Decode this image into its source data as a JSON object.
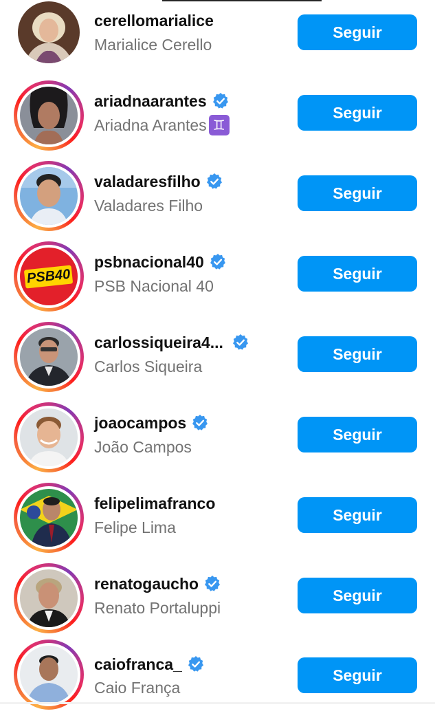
{
  "colors": {
    "follow_button": "#0095f6",
    "verified_badge": "#3897f0",
    "username": "#111111",
    "fullname": "#737373"
  },
  "icons": {
    "verified": "verified-badge-icon",
    "emoji_gemini": "gemini-zodiac-emoji-icon"
  },
  "suggestions": [
    {
      "username": "cerellomarialice",
      "full_name": "Marialice Cerello",
      "verified": false,
      "story_ring": false,
      "follow_label": "Seguir"
    },
    {
      "username": "ariadnaarantes",
      "full_name": "Ariadna Arantes",
      "name_emoji": "♊",
      "verified": true,
      "story_ring": true,
      "follow_label": "Seguir"
    },
    {
      "username": "valadaresfilho",
      "full_name": "Valadares Filho",
      "verified": true,
      "story_ring": true,
      "follow_label": "Seguir"
    },
    {
      "username": "psbnacional40",
      "full_name": "PSB Nacional 40",
      "avatar_text": "PSB40",
      "verified": true,
      "story_ring": true,
      "follow_label": "Seguir"
    },
    {
      "username": "carlossiqueira4...",
      "full_name": "Carlos Siqueira",
      "verified": true,
      "story_ring": true,
      "follow_label": "Seguir"
    },
    {
      "username": "joaocampos",
      "full_name": "João Campos",
      "verified": true,
      "story_ring": true,
      "follow_label": "Seguir"
    },
    {
      "username": "felipelimafranco",
      "full_name": "Felipe Lima",
      "verified": false,
      "story_ring": true,
      "follow_label": "Seguir"
    },
    {
      "username": "renatogaucho",
      "full_name": "Renato Portaluppi",
      "verified": true,
      "story_ring": true,
      "follow_label": "Seguir"
    },
    {
      "username": "caiofranca_",
      "full_name": "Caio França",
      "verified": true,
      "story_ring": true,
      "follow_label": "Seguir"
    }
  ]
}
